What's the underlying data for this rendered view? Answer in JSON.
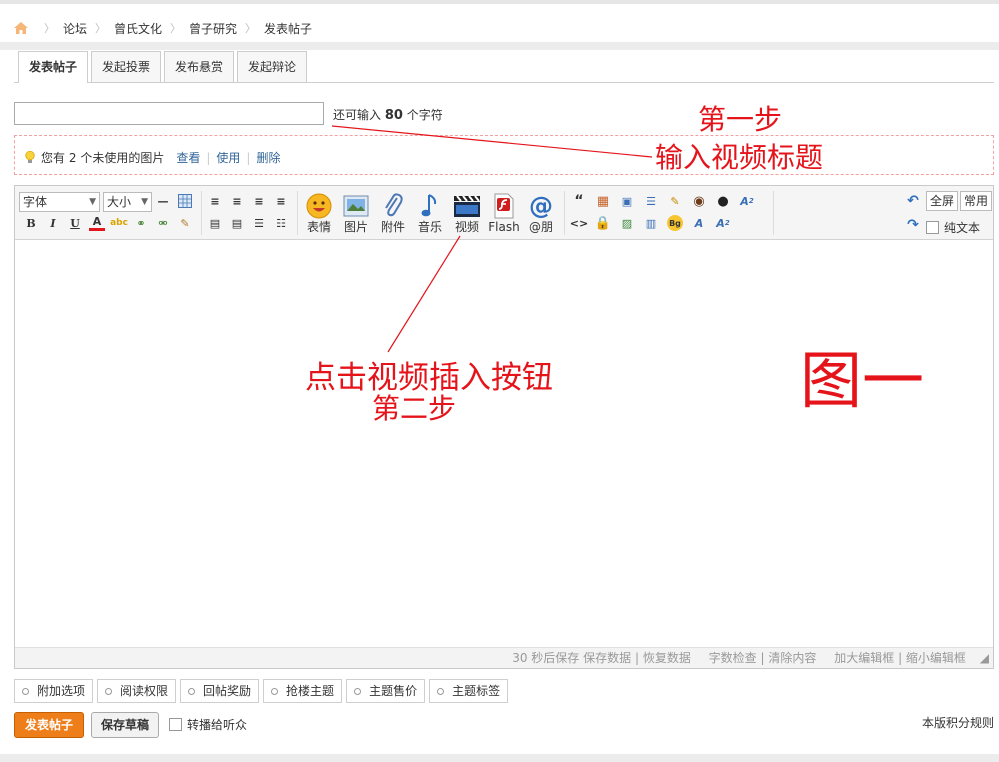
{
  "breadcrumb": [
    "论坛",
    "曾氏文化",
    "曾子研究",
    "发表帖子"
  ],
  "tabs": [
    "发表帖子",
    "发起投票",
    "发布悬赏",
    "发起辩论"
  ],
  "title_hint": {
    "before": "还可输入",
    "count": "80",
    "after": "个字符"
  },
  "notice": {
    "text_before": "您有",
    "count": "2",
    "text_after": "个未使用的图片",
    "links": [
      "查看",
      "使用",
      "删除"
    ]
  },
  "toolbar": {
    "font_select": "字体",
    "size_select": "大小",
    "big_buttons": [
      "表情",
      "图片",
      "附件",
      "音乐",
      "视频",
      "Flash",
      "@朋"
    ],
    "fullscreen": "全屏",
    "common": "常用",
    "plaintext": "纯文本"
  },
  "statusbar": [
    "30 秒后保存",
    "保存数据",
    "恢复数据",
    "字数检查",
    "清除内容",
    "加大编辑框",
    "缩小编辑框"
  ],
  "options": [
    "附加选项",
    "阅读权限",
    "回帖奖励",
    "抢楼主题",
    "主题售价",
    "主题标签"
  ],
  "actions": {
    "submit": "发表帖子",
    "draft": "保存草稿",
    "share": "转播给听众",
    "rules": "本版积分规则"
  },
  "annotations": {
    "step1": "第一步",
    "step1_desc": "输入视频标题",
    "step2_desc": "点击视频插入按钮",
    "step2": "第二步",
    "figure": "图一"
  },
  "colors": {
    "annotation": "#e5141b",
    "submit": "#ee7e1a",
    "link": "#336699"
  }
}
